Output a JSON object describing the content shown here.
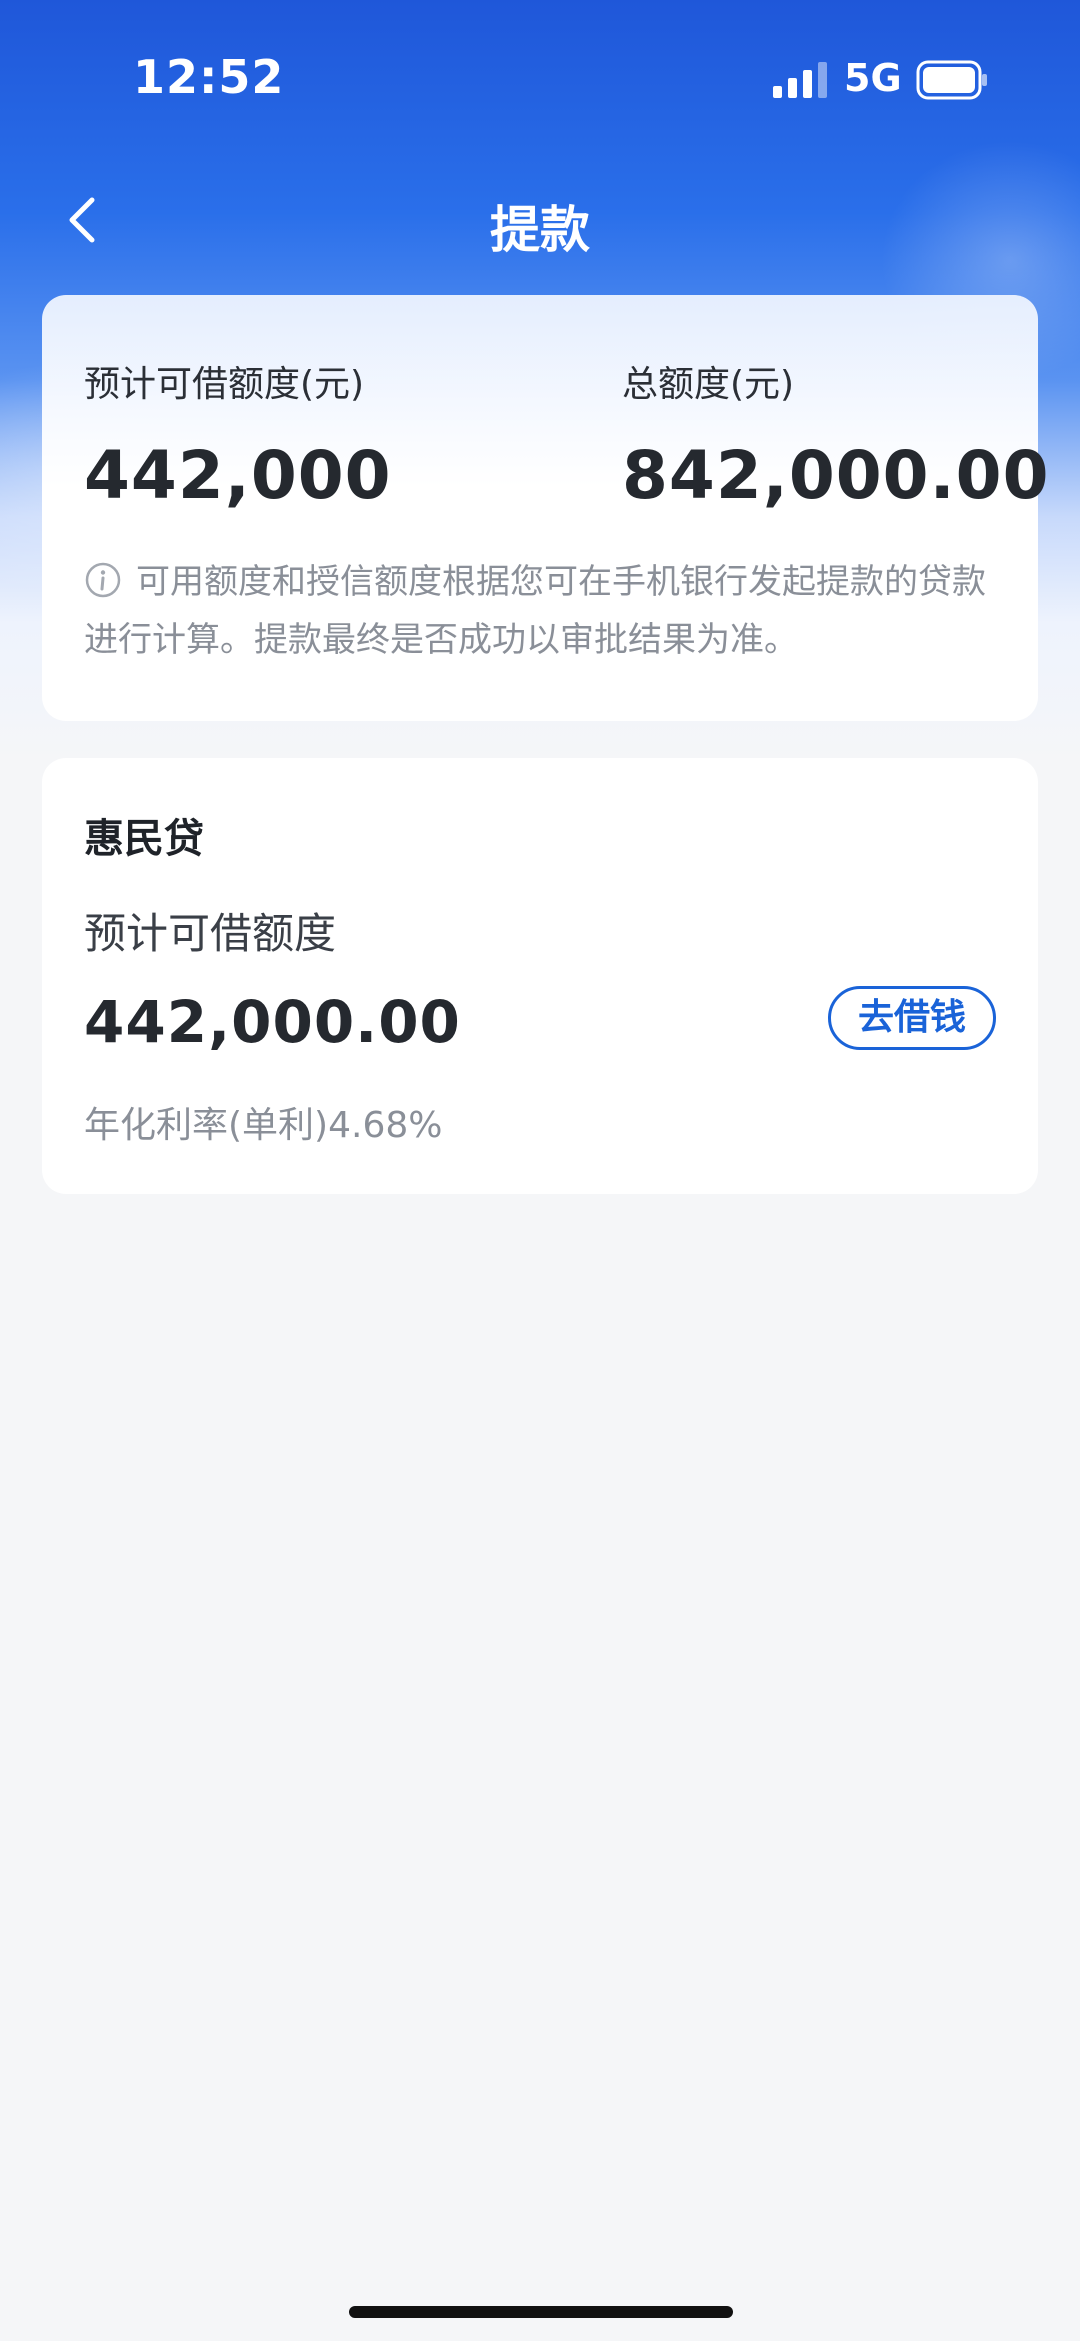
{
  "status_bar": {
    "time": "12:52",
    "network": "5G",
    "signal_icon": "cellular-signal-icon",
    "battery_icon": "battery-icon"
  },
  "nav": {
    "title": "提款",
    "back_icon": "chevron-left-icon"
  },
  "summary": {
    "available_label": "预计可借额度(元)",
    "available_value": "442,000",
    "total_label": "总额度(元)",
    "total_value": "842,000.00",
    "note": "可用额度和授信额度根据您可在手机银行发起提款的贷款进行计算。提款最终是否成功以审批结果为准。",
    "note_icon": "info-icon"
  },
  "product": {
    "name": "惠民贷",
    "quota_label": "预计可借额度",
    "quota_value": "442,000.00",
    "button_label": "去借钱",
    "rate_text": "年化利率(单利)4.68%"
  },
  "colors": {
    "brand_blue": "#1f57d9",
    "accent_blue": "#1a63d8",
    "background": "#f5f6f8"
  }
}
